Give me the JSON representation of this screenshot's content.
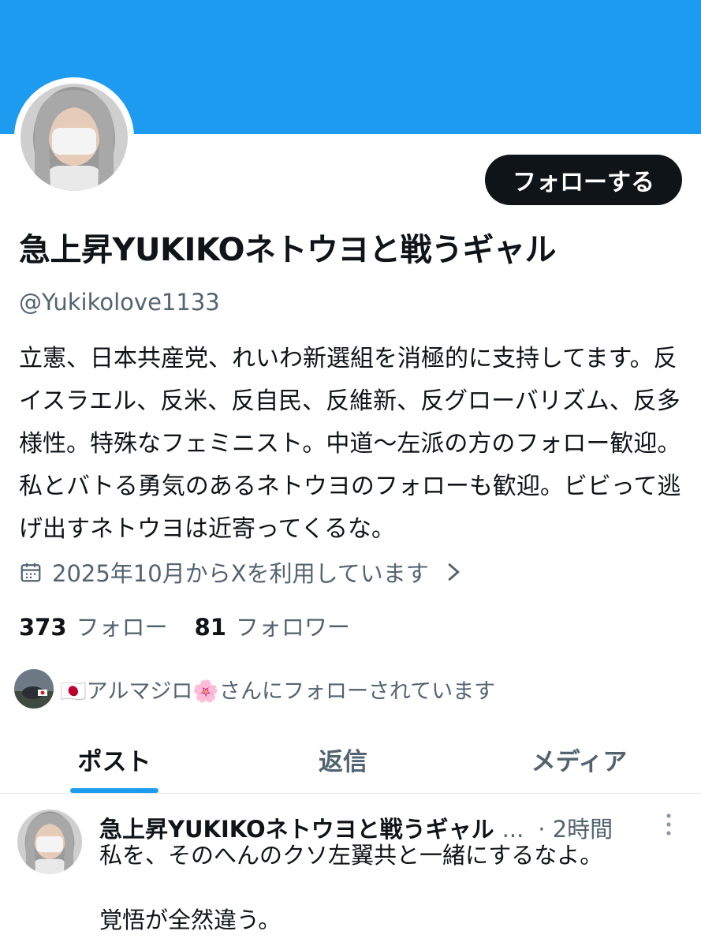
{
  "colors": {
    "accent": "#1d9bf0",
    "text": "#0f1419",
    "muted": "#536471",
    "button_bg": "#0f1419"
  },
  "profile": {
    "follow_button": "フォローする",
    "display_name": "急上昇YUKIKOネトウヨと戦うギャル",
    "handle": "@Yukikolove1133",
    "bio": "立憲、日本共産党、れいわ新選組を消極的に支持してます。反イスラエル、反米、反自民、反維新、反グローバリズム、反多様性。特殊なフェミニスト。中道〜左派の方のフォロー歓迎。私とバトる勇気のあるネトウヨのフォローも歓迎。ビビって逃げ出すネトウヨは近寄ってくるな。",
    "joined": "2025年10月からXを利用しています",
    "following_count": "373",
    "following_label": "フォロー",
    "followers_count": "81",
    "followers_label": "フォロワー",
    "followed_by": "🇯🇵アルマジロ🌸さんにフォローされています"
  },
  "tabs": [
    {
      "label": "ポスト",
      "active": true
    },
    {
      "label": "返信",
      "active": false
    },
    {
      "label": "メディア",
      "active": false
    }
  ],
  "post": {
    "author": "急上昇YUKIKOネトウヨと戦うギャル",
    "ellipsis": "...",
    "time": "· 2時間",
    "text_line1": "私を、そのへんのクソ左翼共と一緒にするなよ。",
    "text_line2": "覚悟が全然違う。"
  },
  "icons": {
    "calendar": "calendar-icon",
    "chevron": "chevron-right-icon",
    "more": "more-vertical-icon"
  }
}
